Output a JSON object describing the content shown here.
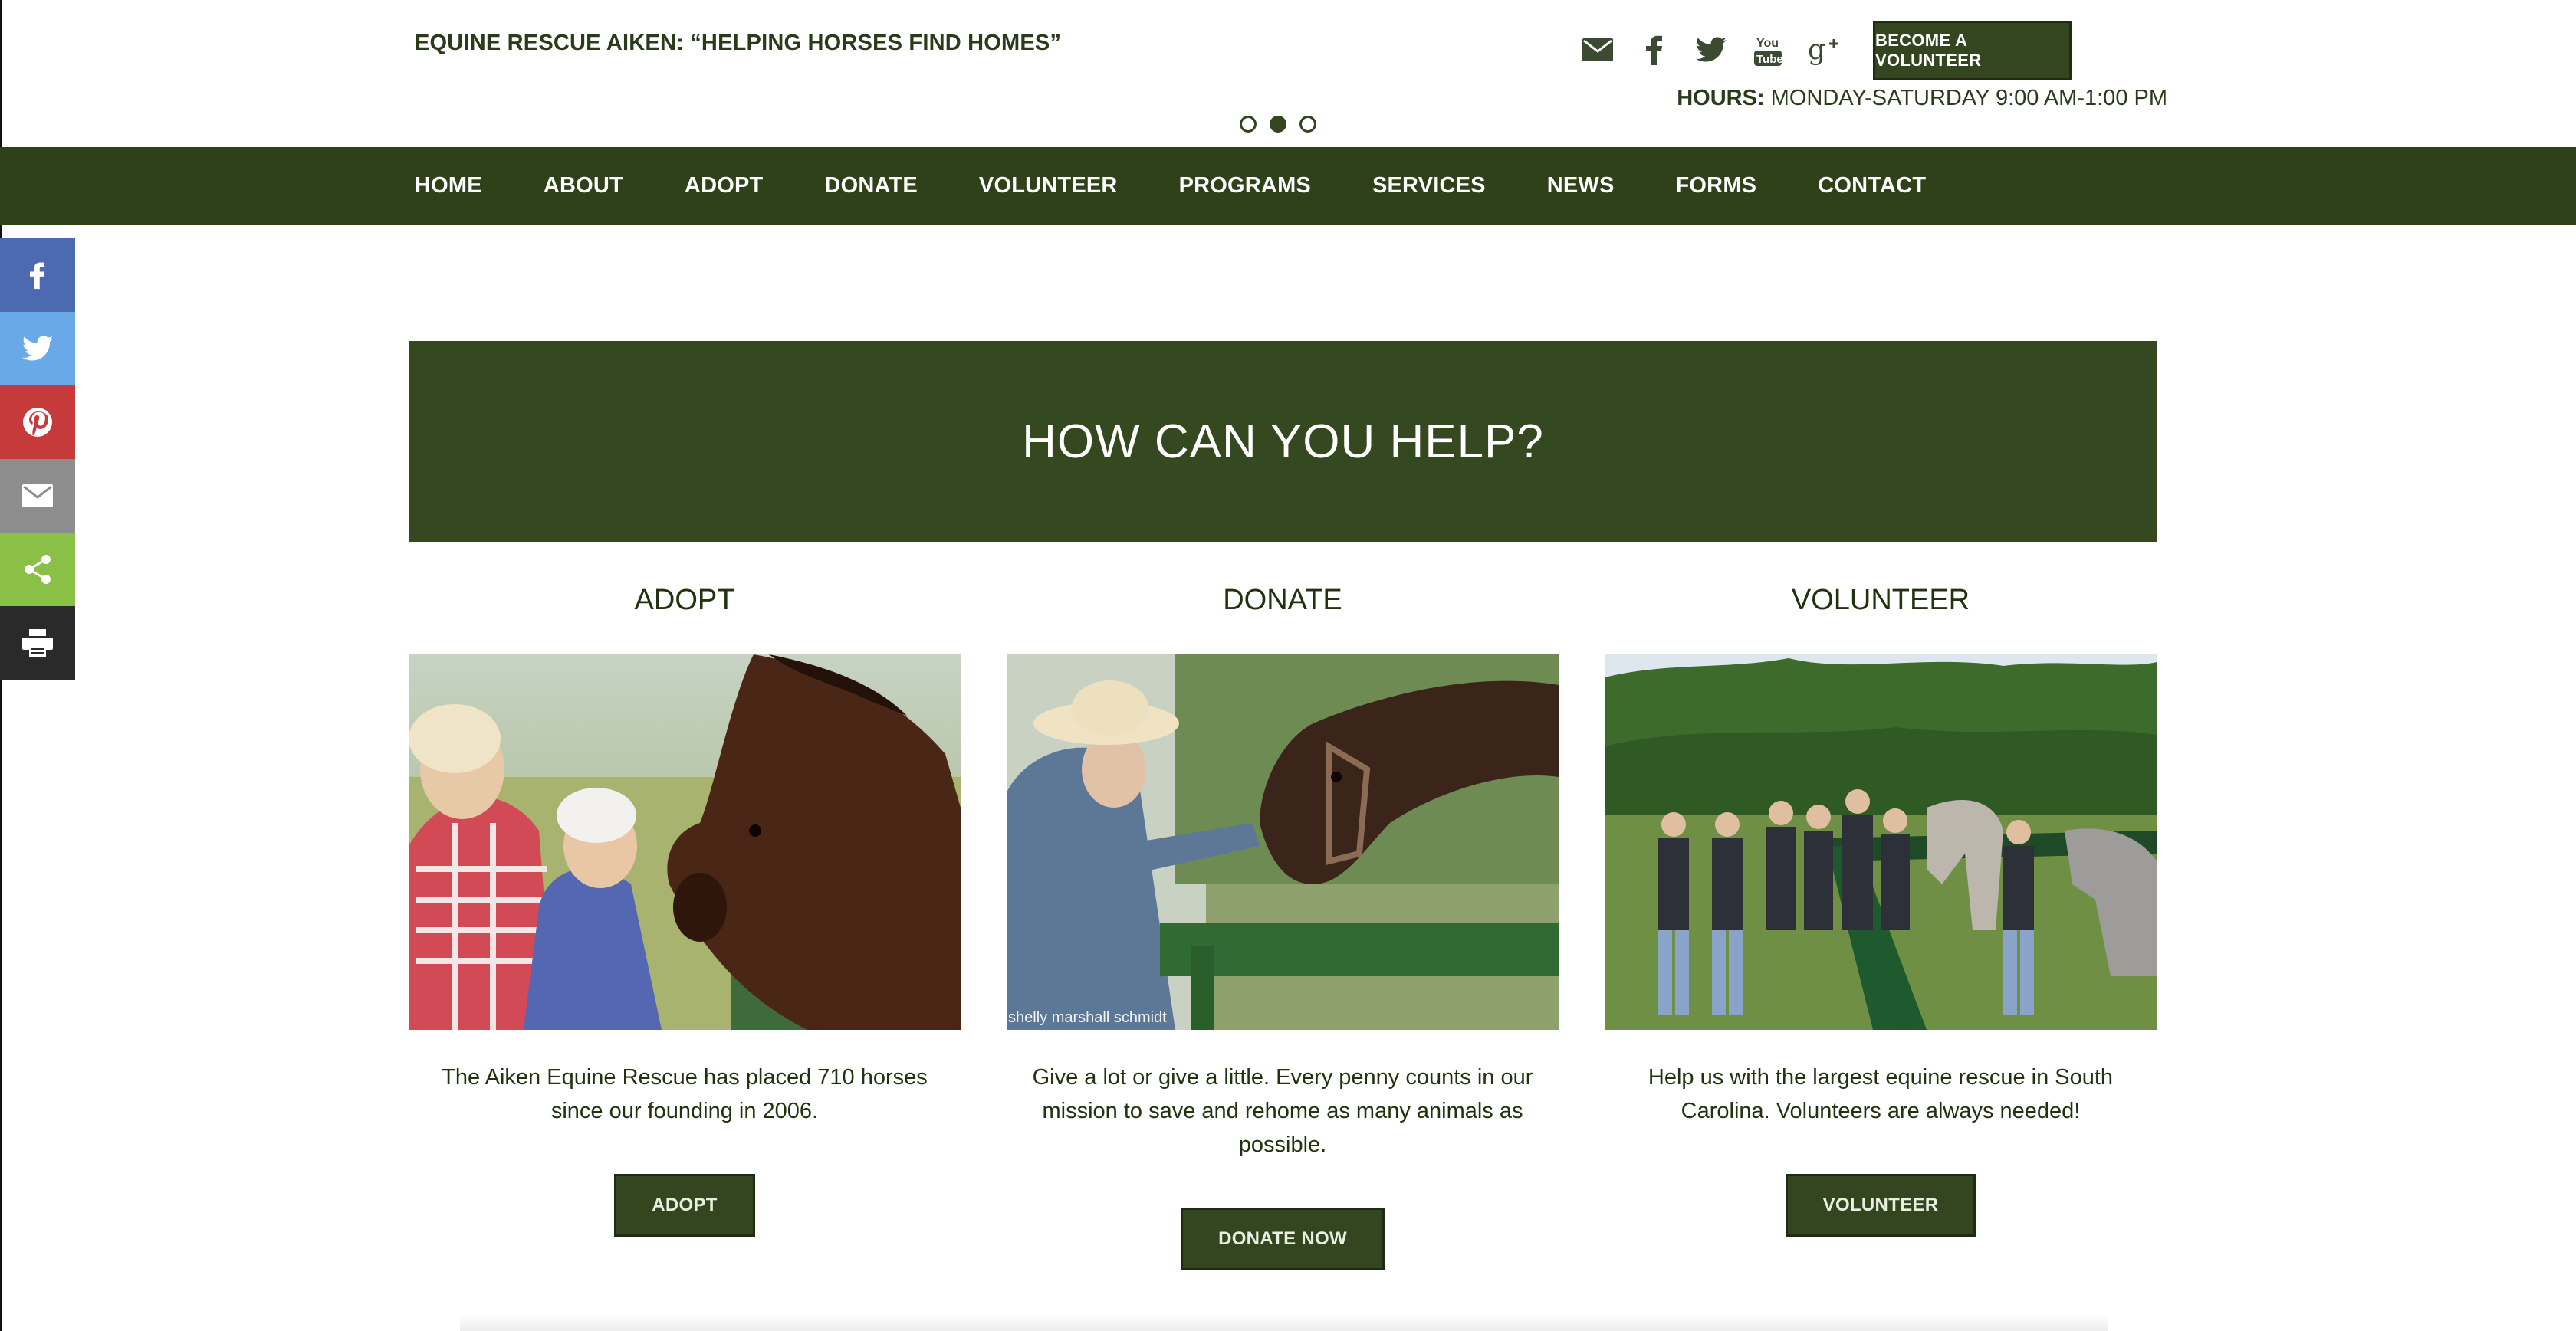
{
  "header": {
    "site_title": "EQUINE RESCUE AIKEN: “HELPING HORSES FIND HOMES”",
    "cta_label": "BECOME A VOLUNTEER",
    "hours_label": "HOURS:",
    "hours_value": "MONDAY-SATURDAY 9:00 AM-1:00 PM",
    "social_icons": [
      "envelope-icon",
      "facebook-icon",
      "twitter-icon",
      "youtube-icon",
      "google-plus-icon"
    ],
    "slider_dots": 3,
    "slider_active": 2
  },
  "nav": {
    "items": [
      {
        "label": "HOME"
      },
      {
        "label": "ABOUT"
      },
      {
        "label": "ADOPT"
      },
      {
        "label": "DONATE"
      },
      {
        "label": "VOLUNTEER"
      },
      {
        "label": "PROGRAMS"
      },
      {
        "label": "SERVICES"
      },
      {
        "label": "NEWS"
      },
      {
        "label": "FORMS"
      },
      {
        "label": "CONTACT"
      }
    ]
  },
  "share_bar": [
    {
      "icon": "facebook-icon",
      "color": "#4b6ab0"
    },
    {
      "icon": "twitter-icon",
      "color": "#6aa9e8"
    },
    {
      "icon": "pinterest-icon",
      "color": "#c63a3b"
    },
    {
      "icon": "email-icon",
      "color": "#8d8d8d"
    },
    {
      "icon": "share-icon",
      "color": "#8ac046"
    },
    {
      "icon": "print-icon",
      "color": "#2a2a2a"
    }
  ],
  "banner": {
    "title": "HOW CAN YOU HELP?"
  },
  "columns": [
    {
      "heading": "ADOPT",
      "text": "The Aiken Equine Rescue has placed 710 horses since our founding in 2006.",
      "button": "ADOPT"
    },
    {
      "heading": "DONATE",
      "text": "Give a lot or give a little. Every penny counts in our mission to save and rehome as many animals as possible.",
      "button": "DONATE NOW",
      "photo_credit": "shelly marshall schmidt"
    },
    {
      "heading": "VOLUNTEER",
      "text": "Help us with the largest equine rescue in South Carolina. Volunteers are always needed!",
      "button": "VOLUNTEER"
    }
  ],
  "colors": {
    "brand_green": "#34461f",
    "nav_green": "#2e4119",
    "text_dark": "#22320f"
  }
}
